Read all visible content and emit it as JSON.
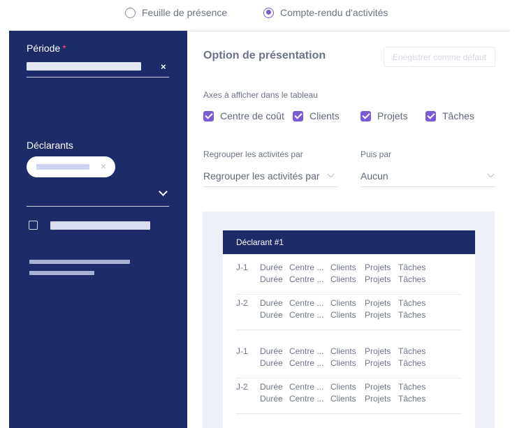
{
  "top_options": [
    {
      "label": "Feuille de présence",
      "selected": false
    },
    {
      "label": "Compte-rendu d'activités",
      "selected": true
    }
  ],
  "sidebar": {
    "period_label": "Période",
    "required_mark": "*",
    "period_clear": "×",
    "declarants_label": "Déclarants",
    "chip_remove": "×"
  },
  "main": {
    "title": "Option de présentation",
    "save_default_label": "Enegistrer comme défaut",
    "axes_label": "Axes à afficher dans le tableau",
    "axes": [
      {
        "label": "Centre de coût",
        "checked": true
      },
      {
        "label": "Clients",
        "checked": true
      },
      {
        "label": "Projets",
        "checked": true
      },
      {
        "label": "Tâches",
        "checked": true
      }
    ],
    "group_by_label": "Regrouper les activités par",
    "group_by_value": "Regrouper les activités par",
    "then_by_label": "Puis par",
    "then_by_value": "Aucun"
  },
  "preview": {
    "declarant_title": "Déclarant #1",
    "columns": [
      "Durée",
      "Centre ...",
      "Clients",
      "Projets",
      "Tâches"
    ],
    "groups": [
      {
        "day": "J-1"
      },
      {
        "day": "J-2"
      },
      {
        "day": "J-1"
      },
      {
        "day": "J-2"
      }
    ]
  },
  "colors": {
    "sidebar_bg": "#1d2b68",
    "accent": "#7b5bd6",
    "required": "#ff4d6a",
    "preview_bg": "#edf0f9"
  }
}
